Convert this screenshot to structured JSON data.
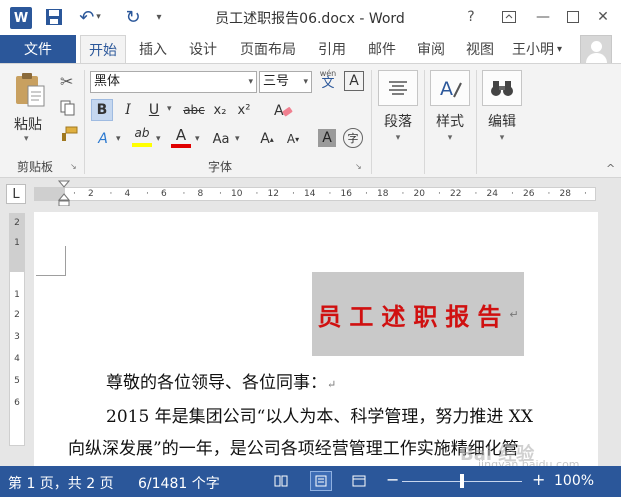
{
  "titlebar": {
    "app_logo": "W",
    "document_title": "员工述职报告06.docx - Word",
    "help": "?",
    "minimize": "—",
    "close": "✕"
  },
  "tabs": {
    "file": "文件",
    "items": [
      "开始",
      "插入",
      "设计",
      "页面布局",
      "引用",
      "邮件",
      "审阅",
      "视图"
    ],
    "active": "开始",
    "user_name": "王小明",
    "user_caret": "▾"
  },
  "ribbon": {
    "clipboard": {
      "paste_label": "粘贴",
      "group_label": "剪贴板"
    },
    "font": {
      "font_name": "黑体",
      "font_size": "三号",
      "bold": "B",
      "italic": "I",
      "underline": "U",
      "strikethrough": "abc",
      "subscript": "x₂",
      "superscript": "x²",
      "text_effects": "A",
      "highlight": "ab",
      "font_color": "A",
      "change_case": "Aa",
      "grow_font": "A",
      "shrink_font": "A",
      "char_shading": "A",
      "enclose_char": "字",
      "phonetic_top": "wén",
      "phonetic_bottom": "文",
      "char_border": "A",
      "group_label": "字体",
      "highlight_color": "#ffff00",
      "font_color_value": "#e00000"
    },
    "paragraph_label": "段落",
    "styles_label": "样式",
    "editing_label": "编辑"
  },
  "ruler": {
    "tab_selector": "L",
    "h_numbers": [
      "2",
      "4",
      "6",
      "8",
      "10",
      "12",
      "14",
      "16",
      "18",
      "20",
      "22",
      "24",
      "26",
      "28",
      "30"
    ],
    "v_numbers": [
      "2",
      "1",
      "1",
      "2",
      "3",
      "4",
      "5",
      "6"
    ]
  },
  "document": {
    "title": "员工述职报告",
    "line1": "尊敬的各位领导、各位同事：",
    "line2": "2015 年是集团公司“以人为本、科学管理，努力推进 XX",
    "line3": "向纵深发展”的一年，是公司各项经营管理工作实施精细化管",
    "para_mark": "↵"
  },
  "statusbar": {
    "page_info": "第 1 页，共 2 页",
    "word_count": "6/1481 个字",
    "zoom_minus": "−",
    "zoom_plus": "+",
    "zoom_level": "100%",
    "zoom_fraction": 0.5
  },
  "watermark": {
    "main": "Bai 经验",
    "sub": "jingyan.baidu.com"
  }
}
